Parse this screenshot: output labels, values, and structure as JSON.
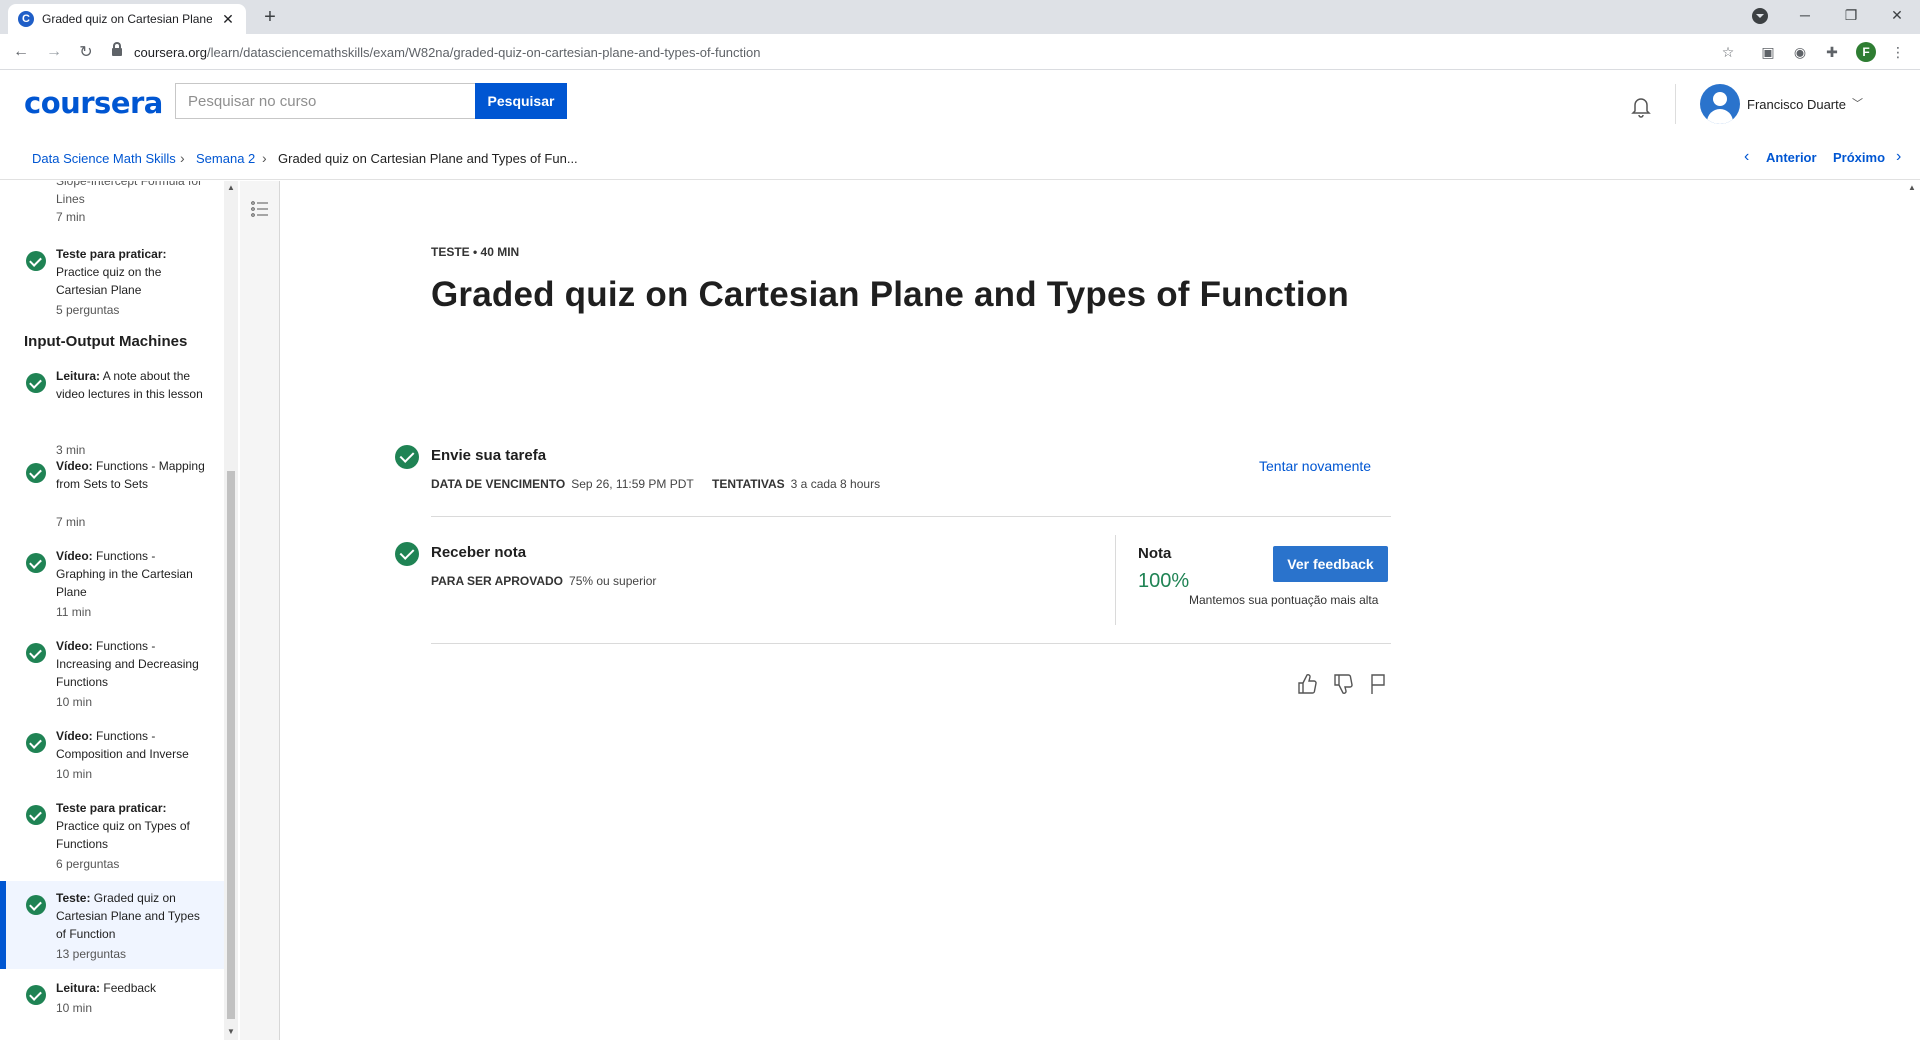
{
  "browser": {
    "tab_title": "Graded quiz on Cartesian Plane a",
    "favicon_letter": "C",
    "url_host": "coursera.org",
    "url_path": "/learn/datasciencemathskills/exam/W82na/graded-quiz-on-cartesian-plane-and-types-of-function",
    "profile_letter": "F"
  },
  "header": {
    "logo": "coursera",
    "search_placeholder": "Pesquisar no curso",
    "search_button": "Pesquisar",
    "user_name": "Francisco Duarte"
  },
  "breadcrumb": {
    "course": "Data Science Math Skills",
    "week": "Semana 2",
    "current": "Graded quiz on Cartesian Plane and Types of Fun...",
    "prev": "Anterior",
    "next": "Próximo"
  },
  "sidebar": {
    "partial_item": {
      "title": "Slope-Intercept Formula for Lines",
      "meta": "7 min"
    },
    "practice1": {
      "kind": "Teste para praticar:",
      "title": "Practice quiz on the Cartesian Plane",
      "meta": "5 perguntas"
    },
    "section": "Input-Output Machines",
    "items": [
      {
        "kind": "Leitura:",
        "title": "A note about the video lectures in this lesson",
        "meta": "3 min"
      },
      {
        "kind": "Vídeo:",
        "title": "Functions - Mapping from Sets to Sets",
        "meta": "7 min"
      },
      {
        "kind": "Vídeo:",
        "title": "Functions - Graphing in the Cartesian Plane",
        "meta": "11 min"
      },
      {
        "kind": "Vídeo:",
        "title": "Functions - Increasing and Decreasing Functions",
        "meta": "10 min"
      },
      {
        "kind": "Vídeo:",
        "title": "Functions - Composition and Inverse",
        "meta": "10 min"
      },
      {
        "kind": "Teste para praticar:",
        "title": "Practice quiz on Types of Functions",
        "meta": "6 perguntas"
      },
      {
        "kind": "Teste:",
        "title": "Graded quiz on Cartesian Plane and Types of Function",
        "meta": "13 perguntas"
      },
      {
        "kind": "Leitura:",
        "title": "Feedback",
        "meta": "10 min"
      }
    ]
  },
  "main": {
    "eyebrow": "TESTE • 40 MIN",
    "title": "Graded quiz on Cartesian Plane and Types of Function",
    "submit": {
      "heading": "Envie sua tarefa",
      "due_label": "DATA DE VENCIMENTO",
      "due_value": "Sep 26, 11:59 PM PDT",
      "attempts_label": "TENTATIVAS",
      "attempts_value": "3 a cada 8 hours",
      "retry": "Tentar novamente"
    },
    "grade": {
      "heading": "Receber nota",
      "pass_label": "PARA SER APROVADO",
      "pass_value": "75% ou superior",
      "grade_label": "Nota",
      "grade_value": "100%",
      "feedback_button": "Ver feedback",
      "note": "Mantemos sua pontuação mais alta"
    }
  },
  "colors": {
    "brand": "#0056d2",
    "success": "#1f8354",
    "button": "#2a73cc"
  }
}
